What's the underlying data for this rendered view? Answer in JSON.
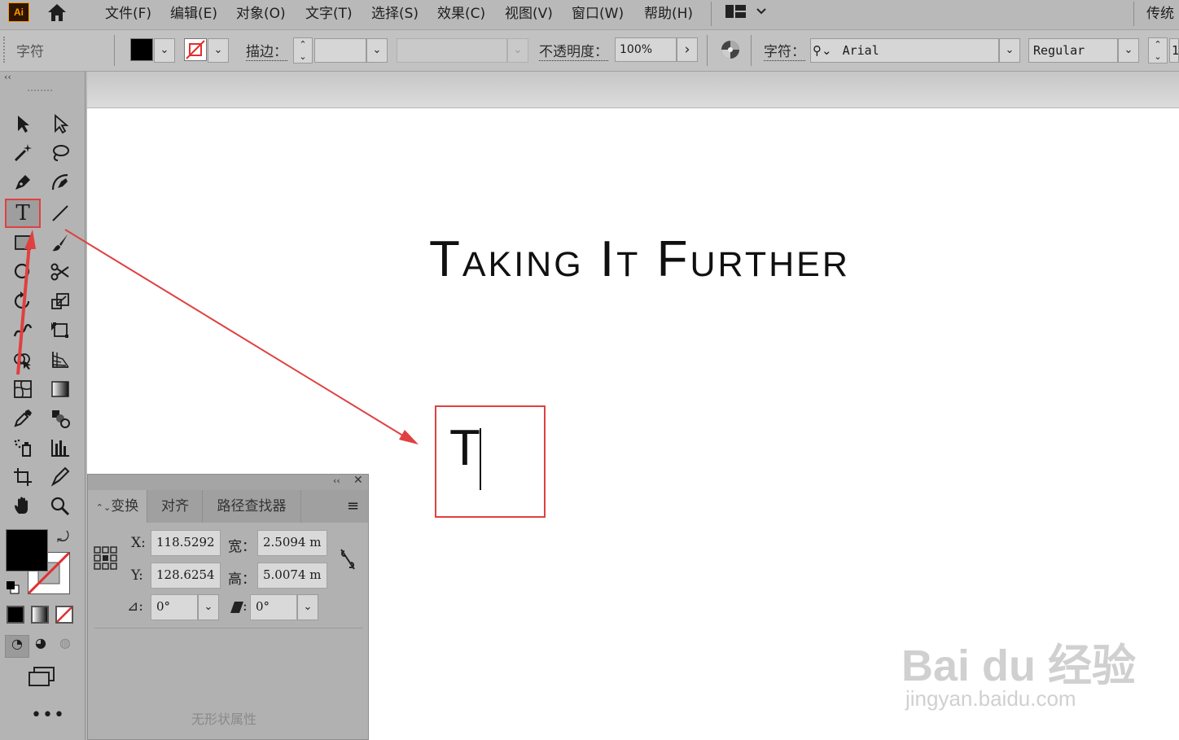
{
  "app": {
    "logo": "Ai",
    "workspace": "传统"
  },
  "menu": [
    "文件(F)",
    "编辑(E)",
    "对象(O)",
    "文字(T)",
    "选择(S)",
    "效果(C)",
    "视图(V)",
    "窗口(W)",
    "帮助(H)"
  ],
  "control_bar": {
    "panel_label": "字符",
    "stroke_label": "描边：",
    "opacity_label": "不透明度：",
    "opacity_value": "100%",
    "char_label": "字符：",
    "font_family": "Arial",
    "font_style": "Regular",
    "size_partial": "1"
  },
  "colors": {
    "accent_red": "#e04040",
    "fill": "#000000",
    "stroke": "none"
  },
  "canvas": {
    "headline": "Taking It Further",
    "typed_text": "T"
  },
  "transform_panel": {
    "tabs": [
      "变换",
      "对齐",
      "路径查找器"
    ],
    "x_label": "X:",
    "x_value": "118.5292",
    "y_label": "Y:",
    "y_value": "128.6254",
    "w_label": "宽：",
    "w_value": "2.5094 m",
    "h_label": "高：",
    "h_value": "5.0074 m",
    "rotate_label": "⊿:",
    "rotate_value": "0°",
    "shear_label": ":",
    "shear_value": "0°",
    "no_shape": "无形状属性"
  },
  "watermark": {
    "main": "Bai du 经验",
    "sub": "jingyan.baidu.com"
  },
  "icons": [
    "selection-icon",
    "direct-selection-icon",
    "magic-wand-icon",
    "lasso-icon",
    "pen-icon",
    "curvature-icon",
    "type-icon",
    "line-segment-icon",
    "rectangle-icon",
    "paintbrush-icon",
    "shaper-icon",
    "scissors-icon",
    "rotate-icon",
    "scale-icon",
    "warp-icon",
    "free-transform-icon",
    "shape-builder-icon",
    "perspective-grid-icon",
    "mesh-icon",
    "gradient-icon",
    "eyedropper-icon",
    "blend-icon",
    "symbol-sprayer-icon",
    "column-graph-icon",
    "artboard-icon",
    "slice-icon",
    "hand-icon",
    "zoom-icon"
  ]
}
